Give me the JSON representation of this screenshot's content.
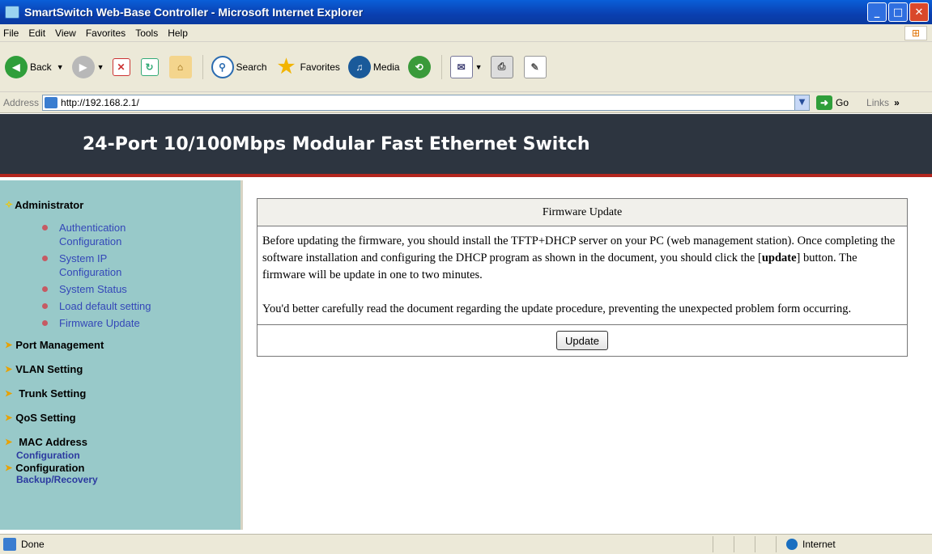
{
  "window": {
    "title": "SmartSwitch Web-Base Controller - Microsoft Internet Explorer"
  },
  "menubar": {
    "items": [
      "File",
      "Edit",
      "View",
      "Favorites",
      "Tools",
      "Help"
    ]
  },
  "toolbar": {
    "back_label": "Back",
    "search_label": "Search",
    "favorites_label": "Favorites",
    "media_label": "Media"
  },
  "addressbar": {
    "label": "Address",
    "url": "http://192.168.2.1/",
    "go_label": "Go",
    "links_label": "Links"
  },
  "banner": {
    "title": "24-Port 10/100Mbps Modular Fast Ethernet Switch"
  },
  "sidebar": {
    "administrator": "Administrator",
    "admin_items": [
      {
        "line1": "Authentication",
        "line2": "Configuration"
      },
      {
        "line1": "System IP",
        "line2": "Configuration"
      },
      {
        "line1": "System Status",
        "line2": ""
      },
      {
        "line1": "Load default setting",
        "line2": ""
      },
      {
        "line1": "Firmware Update",
        "line2": ""
      }
    ],
    "port_management": "Port Management",
    "vlan_setting": "VLAN Setting",
    "trunk_setting": "Trunk Setting",
    "qos_setting": "QoS Setting",
    "mac_address": "MAC Address",
    "mac_address_sub": "Configuration",
    "configuration": "Configuration",
    "configuration_sub": "Backup/Recovery"
  },
  "firmware": {
    "header": "Firmware Update",
    "para1_a": "Before updating the firmware, you should install the TFTP+DHCP server on your PC (web management station). Once completing the software installation and configuring the DHCP program as shown in the document, you should click the [",
    "para1_bold": "update",
    "para1_b": "] button. The firmware will be update in one to two minutes.",
    "para2": "You'd better carefully read the document regarding the update procedure, preventing the unexpected problem form occurring.",
    "button_label": "Update"
  },
  "statusbar": {
    "status": "Done",
    "zone": "Internet"
  }
}
